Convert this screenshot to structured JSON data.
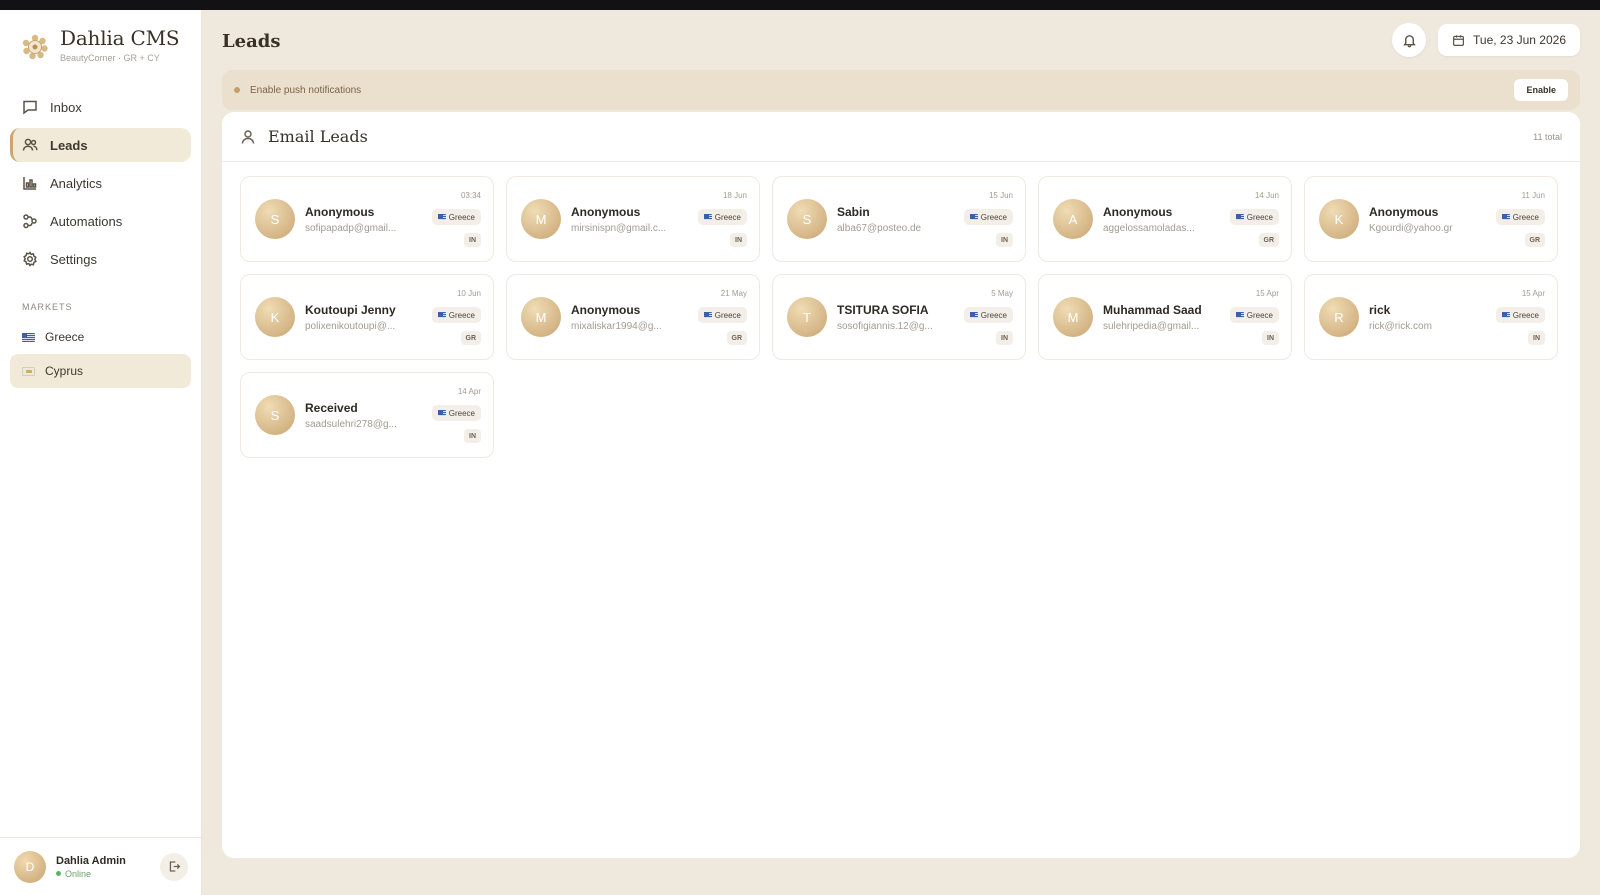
{
  "brand": {
    "name": "Dahlia CMS",
    "subtitle": "BeautyCorner · GR + CY"
  },
  "nav": [
    {
      "label": "Inbox",
      "icon": "chat-icon",
      "active": false
    },
    {
      "label": "Leads",
      "icon": "users-icon",
      "active": true
    },
    {
      "label": "Analytics",
      "icon": "bar-chart-icon",
      "active": false
    },
    {
      "label": "Automations",
      "icon": "flow-icon",
      "active": false
    },
    {
      "label": "Settings",
      "icon": "gear-icon",
      "active": false
    }
  ],
  "markets": {
    "label": "MARKETS",
    "items": [
      {
        "label": "Greece",
        "flag": "greece-flag-icon",
        "active": false
      },
      {
        "label": "Cyprus",
        "flag": "cyprus-flag-icon",
        "active": true
      }
    ]
  },
  "user": {
    "initial": "D",
    "name": "Dahlia Admin",
    "status": "Online"
  },
  "header": {
    "title": "Leads",
    "date": "Tue, 23 Jun 2026"
  },
  "banner": {
    "text": "Enable push notifications",
    "button": "Enable"
  },
  "panel": {
    "title": "Email Leads",
    "total": "11 total"
  },
  "leads": [
    {
      "initial": "S",
      "name": "Anonymous",
      "email": "sofipapadp@gmail...",
      "date": "03:34",
      "market": "Greece",
      "tag": "IN"
    },
    {
      "initial": "M",
      "name": "Anonymous",
      "email": "mirsinispn@gmail.c...",
      "date": "18 Jun",
      "market": "Greece",
      "tag": "IN"
    },
    {
      "initial": "S",
      "name": "Sabin",
      "email": "alba67@posteo.de",
      "date": "15 Jun",
      "market": "Greece",
      "tag": "IN"
    },
    {
      "initial": "A",
      "name": "Anonymous",
      "email": "aggelossamoladas...",
      "date": "14 Jun",
      "market": "Greece",
      "tag": "GR"
    },
    {
      "initial": "K",
      "name": "Anonymous",
      "email": "Kgourdi@yahoo.gr",
      "date": "11 Jun",
      "market": "Greece",
      "tag": "GR"
    },
    {
      "initial": "K",
      "name": "Koutoupi Jenny",
      "email": "polixenikoutoupi@...",
      "date": "10 Jun",
      "market": "Greece",
      "tag": "GR"
    },
    {
      "initial": "M",
      "name": "Anonymous",
      "email": "mixaliskar1994@g...",
      "date": "21 May",
      "market": "Greece",
      "tag": "GR"
    },
    {
      "initial": "T",
      "name": "TSITURA SOFIA",
      "email": "sosofigiannis.12@g...",
      "date": "5 May",
      "market": "Greece",
      "tag": "IN"
    },
    {
      "initial": "M",
      "name": "Muhammad Saad",
      "email": "sulehripedia@gmail...",
      "date": "15 Apr",
      "market": "Greece",
      "tag": "IN"
    },
    {
      "initial": "R",
      "name": "rick",
      "email": "rick@rick.com",
      "date": "15 Apr",
      "market": "Greece",
      "tag": "IN"
    },
    {
      "initial": "S",
      "name": "Received",
      "email": "saadsulehri278@g...",
      "date": "14 Apr",
      "market": "Greece",
      "tag": "IN"
    }
  ],
  "colors": {
    "accent": "#c9a770",
    "background": "#efe8dc",
    "panel": "#ffffff",
    "online": "#5fb55f"
  }
}
